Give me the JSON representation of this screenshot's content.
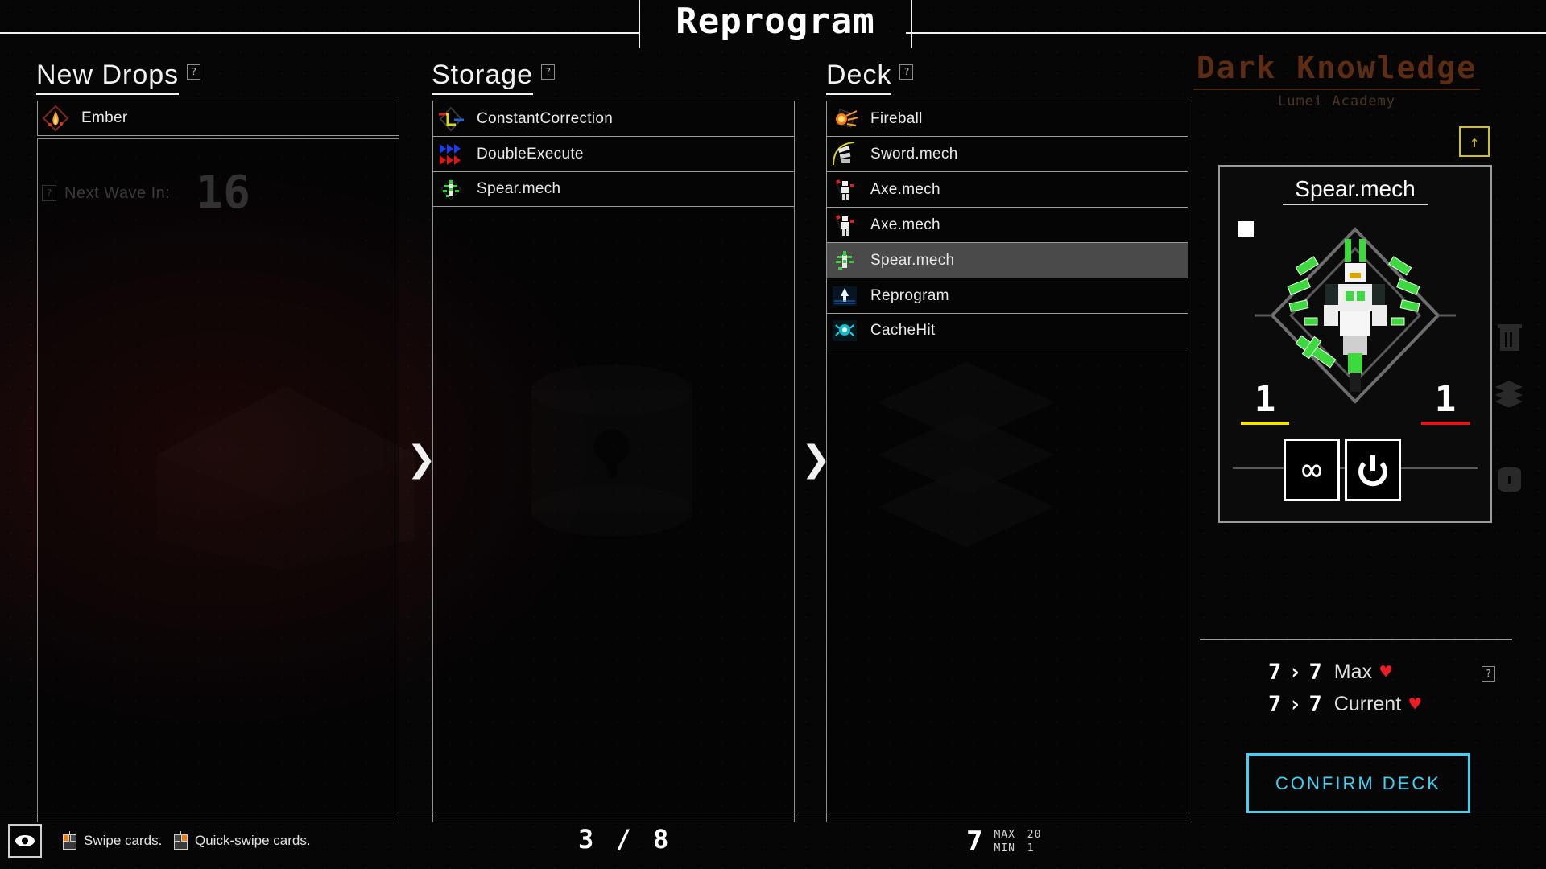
{
  "window": {
    "title": "Reprogram",
    "background_title": "Dark Knowledge",
    "background_subtitle": "Lumei Academy"
  },
  "background_hud": {
    "next_wave_label": "Next Wave In:",
    "next_wave_value": "16",
    "help_marker": "?"
  },
  "columns": {
    "new_drops": {
      "header": "New Drops",
      "help_marker": "?",
      "cards": [
        {
          "name": "Ember",
          "icon": "ember-flame-icon"
        }
      ]
    },
    "storage": {
      "header": "Storage",
      "help_marker": "?",
      "cards": [
        {
          "name": "ConstantCorrection",
          "icon": "constant-correction-icon"
        },
        {
          "name": "DoubleExecute",
          "icon": "double-execute-icon"
        },
        {
          "name": "Spear.mech",
          "icon": "spear-mech-icon"
        }
      ]
    },
    "deck": {
      "header": "Deck",
      "help_marker": "?",
      "cards": [
        {
          "name": "Fireball",
          "icon": "fireball-icon",
          "selected": false
        },
        {
          "name": "Sword.mech",
          "icon": "sword-mech-icon",
          "selected": false
        },
        {
          "name": "Axe.mech",
          "icon": "axe-mech-icon",
          "selected": false
        },
        {
          "name": "Axe.mech",
          "icon": "axe-mech-icon",
          "selected": false
        },
        {
          "name": "Spear.mech",
          "icon": "spear-mech-icon",
          "selected": true
        },
        {
          "name": "Reprogram",
          "icon": "reprogram-icon",
          "selected": false
        },
        {
          "name": "CacheHit",
          "icon": "cachehit-icon",
          "selected": false
        }
      ]
    }
  },
  "card_detail": {
    "title": "Spear.mech",
    "cost_marker": "",
    "stat_left": "1",
    "stat_right": "1",
    "stat_left_color": "#f2e500",
    "stat_right_color": "#e4161b",
    "ability_icons": [
      {
        "name": "infinity-icon",
        "glyph": "∞"
      },
      {
        "name": "power-icon",
        "glyph": "power"
      }
    ]
  },
  "health_panel": {
    "rows": [
      {
        "from": "7",
        "arrow": "›",
        "to": "7",
        "label": "Max",
        "heart": "♥"
      },
      {
        "from": "7",
        "arrow": "›",
        "to": "7",
        "label": "Current",
        "heart": "♥"
      }
    ],
    "help_marker": "?",
    "heart_color": "#ee1c25"
  },
  "confirm_button": {
    "label": "CONFIRM DECK",
    "color": "#3fd2f5"
  },
  "top_right_button": {
    "name": "upgrade-button",
    "glyph": "↑",
    "color": "#cfc21a"
  },
  "bottom_bar": {
    "eye_button": "eye-icon",
    "hints": [
      {
        "text": "Swipe cards.",
        "button": "left"
      },
      {
        "text": "Quick-swipe cards.",
        "button": "right"
      }
    ],
    "storage_count": "3 / 8",
    "deck_count": "7",
    "deck_max_label": "MAX",
    "deck_max_value": "20",
    "deck_min_label": "MIN",
    "deck_min_value": "1"
  }
}
